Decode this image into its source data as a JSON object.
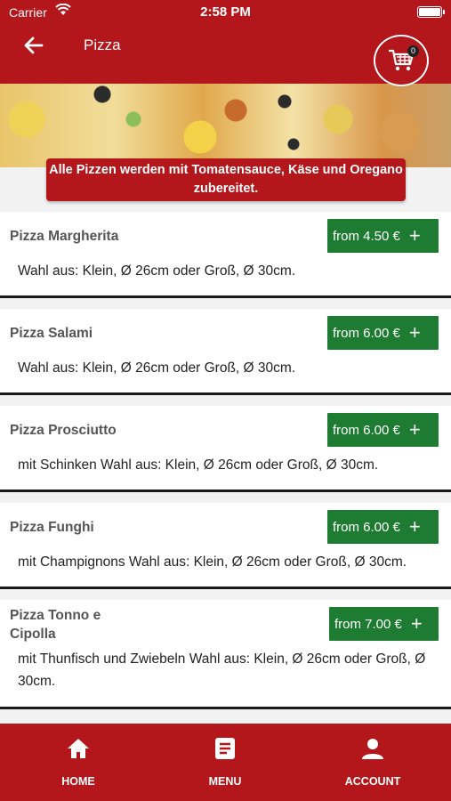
{
  "status": {
    "carrier": "Carrier",
    "time": "2:58 PM"
  },
  "header": {
    "title": "Pizza",
    "cart_count": "0"
  },
  "notice": "Alle Pizzen werden mit Tomatensauce, Käse und Oregano zubereitet.",
  "products": [
    {
      "name": "Pizza Margherita",
      "price": "from 4.50 €",
      "description": "Wahl aus: Klein, Ø 26cm oder Groß, Ø 30cm."
    },
    {
      "name": "Pizza Salami",
      "price": "from 6.00 €",
      "description": "Wahl aus: Klein, Ø 26cm oder Groß, Ø 30cm."
    },
    {
      "name": "Pizza Prosciutto",
      "price": "from 6.00 €",
      "description": "mit Schinken  Wahl aus: Klein, Ø 26cm oder Groß, Ø 30cm."
    },
    {
      "name": "Pizza Funghi",
      "price": "from 6.00 €",
      "description": "mit Champignons  Wahl aus: Klein, Ø 26cm oder Groß, Ø 30cm."
    },
    {
      "name": "Pizza Tonno e Cipolla",
      "price": "from 7.00 €",
      "description": "mit Thunfisch und Zwiebeln  Wahl aus: Klein, Ø 26cm oder Groß, Ø 30cm."
    }
  ],
  "nav": {
    "home": "HOME",
    "menu": "MENU",
    "account": "ACCOUNT"
  },
  "colors": {
    "primary": "#b3171c",
    "price_button": "#1e7b32"
  }
}
